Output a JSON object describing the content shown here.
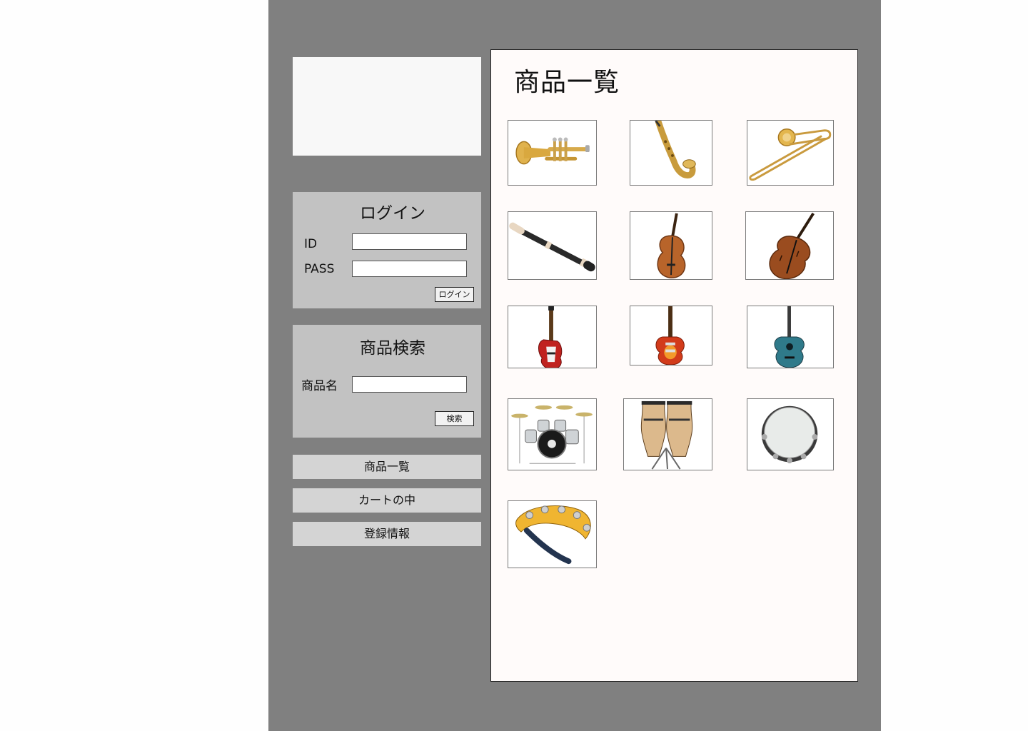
{
  "login": {
    "title": "ログイン",
    "id_label": "ID",
    "pass_label": "PASS",
    "id_value": "",
    "pass_value": "",
    "button_label": "ログイン"
  },
  "search": {
    "title": "商品検索",
    "name_label": "商品名",
    "name_value": "",
    "button_label": "検索"
  },
  "nav": {
    "items": [
      {
        "label": "商品一覧"
      },
      {
        "label": "カートの中"
      },
      {
        "label": "登録情報"
      }
    ]
  },
  "main": {
    "title": "商品一覧",
    "products": [
      {
        "icon": "trumpet-icon"
      },
      {
        "icon": "saxophone-icon"
      },
      {
        "icon": "trombone-icon"
      },
      {
        "icon": "recorder-icon"
      },
      {
        "icon": "cello-icon"
      },
      {
        "icon": "violin-icon"
      },
      {
        "icon": "bass-guitar-icon"
      },
      {
        "icon": "electric-guitar-icon"
      },
      {
        "icon": "acoustic-guitar-icon"
      },
      {
        "icon": "drum-kit-icon"
      },
      {
        "icon": "conga-drums-icon"
      },
      {
        "icon": "tambourine-icon"
      },
      {
        "icon": "half-moon-tambourine-icon"
      }
    ]
  },
  "colors": {
    "page_background": "#808080",
    "panel_background": "#c2c2c2",
    "nav_button_background": "#d4d4d4",
    "content_background": "#fffbfa"
  }
}
